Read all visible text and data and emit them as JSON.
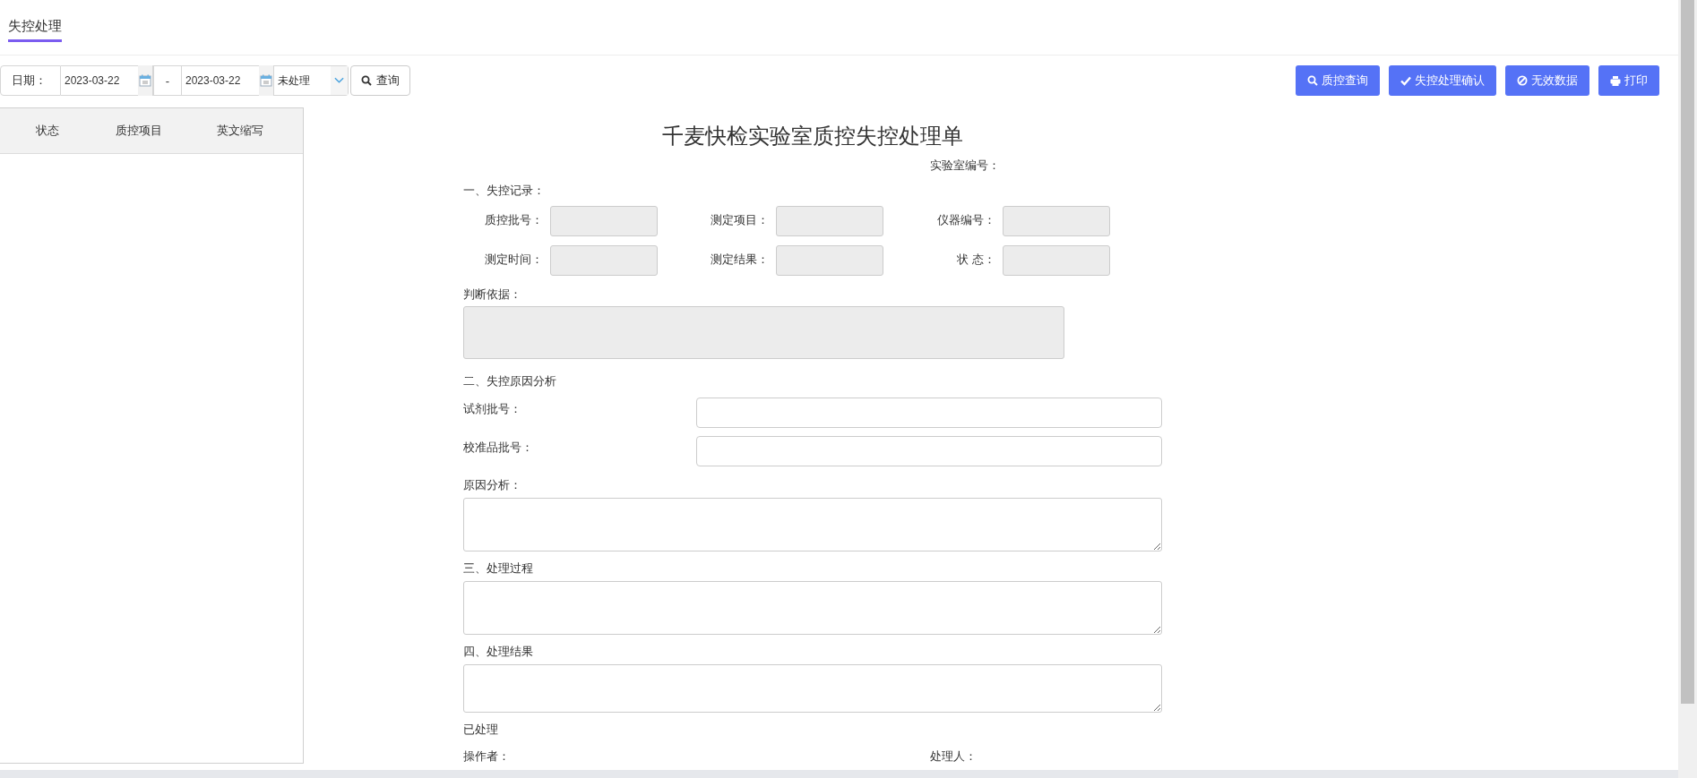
{
  "tabs": [
    {
      "label": "失控处理",
      "selected": true
    }
  ],
  "toolbar": {
    "date_label": "日期：",
    "date_from": "2023-03-22",
    "separator": "-",
    "date_to": "2023-03-22",
    "status_select": "未处理",
    "query_button": "查询"
  },
  "actions": [
    {
      "label": "质控查询",
      "kind": "search"
    },
    {
      "label": "失控处理确认",
      "kind": "check"
    },
    {
      "label": "无效数据",
      "kind": "ban"
    },
    {
      "label": "打印",
      "kind": "print"
    }
  ],
  "table": {
    "columns": [
      "状态",
      "质控项目",
      "英文缩写"
    ]
  },
  "form": {
    "title": "千麦快检实验室质控失控处理单",
    "lab_number_label": "实验室编号：",
    "record": {
      "heading": "一、失控记录：",
      "fields": [
        {
          "label": "质控批号：",
          "disabled": true
        },
        {
          "label": "测定项目：",
          "disabled": true
        },
        {
          "label": "仪器编号：",
          "disabled": true
        },
        {
          "label": "测定时间：",
          "disabled": true
        },
        {
          "label": "测定结果：",
          "disabled": true
        },
        {
          "label": "状 态：",
          "disabled": true
        }
      ],
      "basis": {
        "label": "判断依据：",
        "disabled": true
      }
    },
    "analysis": {
      "heading": "二、失控原因分析",
      "reagent_label": "试剂批号：",
      "calibrator_label": "校准品批号：",
      "cause_label": "原因分析："
    },
    "process": {
      "heading": "三、处理过程"
    },
    "result": {
      "heading": "四、处理结果"
    },
    "status_text": "已处理",
    "operator_label": "操作者：",
    "handler_label": "处理人："
  }
}
